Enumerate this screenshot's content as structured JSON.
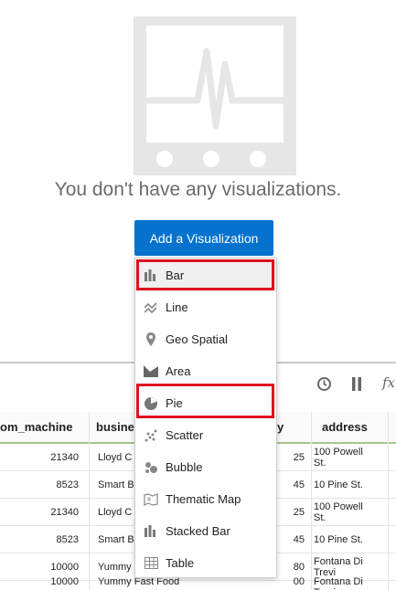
{
  "empty_state": {
    "message": "You don't have any visualizations.",
    "add_button_label": "Add a Visualization"
  },
  "menu": {
    "items": [
      {
        "label": "Bar",
        "icon": "bar-chart-icon",
        "highlighted": true
      },
      {
        "label": "Line",
        "icon": "line-chart-icon"
      },
      {
        "label": "Geo Spatial",
        "icon": "map-pin-icon"
      },
      {
        "label": "Area",
        "icon": "area-chart-icon"
      },
      {
        "label": "Pie",
        "icon": "pie-chart-icon",
        "highlighted": true
      },
      {
        "label": "Scatter",
        "icon": "scatter-chart-icon"
      },
      {
        "label": "Bubble",
        "icon": "bubble-chart-icon"
      },
      {
        "label": "Thematic Map",
        "icon": "thematic-map-icon"
      },
      {
        "label": "Stacked Bar",
        "icon": "stacked-bar-icon"
      },
      {
        "label": "Table",
        "icon": "table-icon"
      }
    ]
  },
  "toolbar": {
    "icons": [
      "clock-icon",
      "pause-icon",
      "function-icon"
    ],
    "function_label": "fx"
  },
  "table": {
    "columns": [
      "om_machine",
      "busine",
      "ory",
      "address"
    ],
    "rows": [
      {
        "machine": "21340",
        "business": "Lloyd C",
        "category": "25",
        "address": "100 Powell St."
      },
      {
        "machine": "8523",
        "business": "Smart B",
        "category": "45",
        "address": "10 Pine St."
      },
      {
        "machine": "21340",
        "business": "Lloyd C",
        "category": "25",
        "address": "100 Powell St."
      },
      {
        "machine": "8523",
        "business": "Smart B",
        "category": "45",
        "address": "10 Pine St."
      },
      {
        "machine": "10000",
        "business": "Yummy",
        "category": "80",
        "address": "Fontana Di Trevi"
      },
      {
        "machine": "10000",
        "business": "Yummy Fast Food",
        "category": "00",
        "address": "Fontana Di Trevi"
      }
    ]
  },
  "colors": {
    "accent": "#0572ce",
    "highlight_box": "#e0111e",
    "header_underline": "#a3c78b"
  }
}
